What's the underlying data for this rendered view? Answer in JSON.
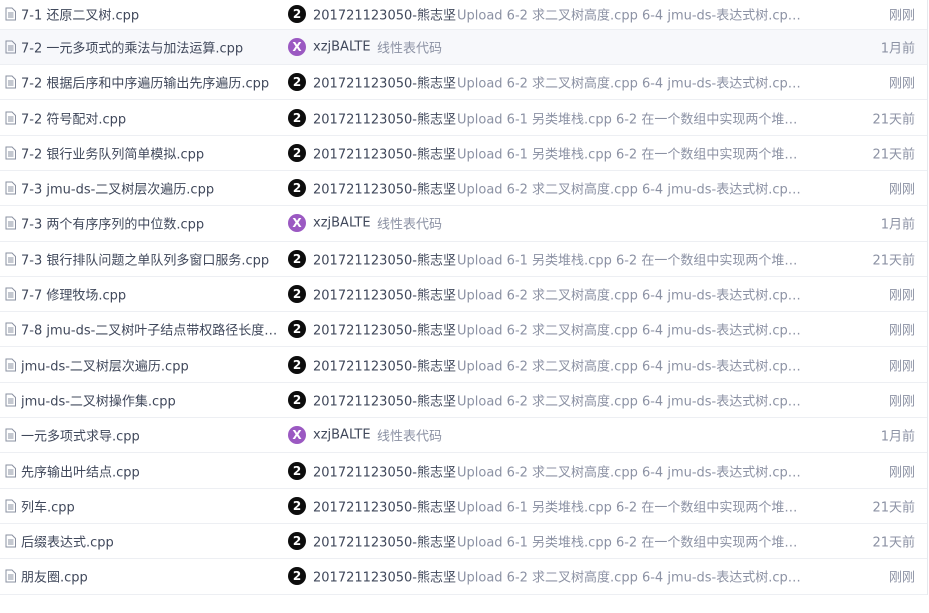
{
  "colors": {
    "avatar_black": "#0d0d0d",
    "avatar_purple": "#9b59c2",
    "link_text": "#40485b",
    "muted_text": "#8c92a4"
  },
  "files": [
    {
      "name": "7-1 还原二叉树.cpp",
      "avatar": "2",
      "avatar_style": "black",
      "author": "201721123050-熊志坚",
      "message": "Upload 6-2 求二叉树高度.cpp 6-4 jmu-ds-表达式树.cpp 7...",
      "time": "刚刚",
      "icon": "file-icon"
    },
    {
      "name": "7-2 一元多项式的乘法与加法运算.cpp",
      "avatar": "X",
      "avatar_style": "purple",
      "author": "xzjBALTE",
      "message": "线性表代码",
      "time": "1月前",
      "icon": "file-icon"
    },
    {
      "name": "7-2 根据后序和中序遍历输出先序遍历.cpp",
      "avatar": "2",
      "avatar_style": "black",
      "author": "201721123050-熊志坚",
      "message": "Upload 6-2 求二叉树高度.cpp 6-4 jmu-ds-表达式树.cpp 7...",
      "time": "刚刚",
      "icon": "file-icon"
    },
    {
      "name": "7-2 符号配对.cpp",
      "avatar": "2",
      "avatar_style": "black",
      "author": "201721123050-熊志坚",
      "message": "Upload 6-1 另类堆栈.cpp 6-2 在一个数组中实现两个堆栈...",
      "time": "21天前",
      "icon": "file-icon"
    },
    {
      "name": "7-2 银行业务队列简单模拟.cpp",
      "avatar": "2",
      "avatar_style": "black",
      "author": "201721123050-熊志坚",
      "message": "Upload 6-1 另类堆栈.cpp 6-2 在一个数组中实现两个堆栈...",
      "time": "21天前",
      "icon": "file-icon"
    },
    {
      "name": "7-3 jmu-ds-二叉树层次遍历.cpp",
      "avatar": "2",
      "avatar_style": "black",
      "author": "201721123050-熊志坚",
      "message": "Upload 6-2 求二叉树高度.cpp 6-4 jmu-ds-表达式树.cpp 7...",
      "time": "刚刚",
      "icon": "file-icon"
    },
    {
      "name": "7-3 两个有序序列的中位数.cpp",
      "avatar": "X",
      "avatar_style": "purple",
      "author": "xzjBALTE",
      "message": "线性表代码",
      "time": "1月前",
      "icon": "file-icon"
    },
    {
      "name": "7-3 银行排队问题之单队列多窗口服务.cpp",
      "avatar": "2",
      "avatar_style": "black",
      "author": "201721123050-熊志坚",
      "message": "Upload 6-1 另类堆栈.cpp 6-2 在一个数组中实现两个堆栈...",
      "time": "21天前",
      "icon": "file-icon"
    },
    {
      "name": "7-7 修理牧场.cpp",
      "avatar": "2",
      "avatar_style": "black",
      "author": "201721123050-熊志坚",
      "message": "Upload 6-2 求二叉树高度.cpp 6-4 jmu-ds-表达式树.cpp 7...",
      "time": "刚刚",
      "icon": "file-icon"
    },
    {
      "name": "7-8 jmu-ds-二叉树叶子结点带权路径长度和...",
      "avatar": "2",
      "avatar_style": "black",
      "author": "201721123050-熊志坚",
      "message": "Upload 6-2 求二叉树高度.cpp 6-4 jmu-ds-表达式树.cpp 7...",
      "time": "刚刚",
      "icon": "file-icon"
    },
    {
      "name": "jmu-ds-二叉树层次遍历.cpp",
      "avatar": "2",
      "avatar_style": "black",
      "author": "201721123050-熊志坚",
      "message": "Upload 6-2 求二叉树高度.cpp 6-4 jmu-ds-表达式树.cpp 7...",
      "time": "刚刚",
      "icon": "file-icon"
    },
    {
      "name": "jmu-ds-二叉树操作集.cpp",
      "avatar": "2",
      "avatar_style": "black",
      "author": "201721123050-熊志坚",
      "message": "Upload 6-2 求二叉树高度.cpp 6-4 jmu-ds-表达式树.cpp 7...",
      "time": "刚刚",
      "icon": "file-icon"
    },
    {
      "name": "一元多项式求导.cpp",
      "avatar": "X",
      "avatar_style": "purple",
      "author": "xzjBALTE",
      "message": "线性表代码",
      "time": "1月前",
      "icon": "file-icon"
    },
    {
      "name": "先序输出叶结点.cpp",
      "avatar": "2",
      "avatar_style": "black",
      "author": "201721123050-熊志坚",
      "message": "Upload 6-2 求二叉树高度.cpp 6-4 jmu-ds-表达式树.cpp 7...",
      "time": "刚刚",
      "icon": "file-icon"
    },
    {
      "name": "列车.cpp",
      "avatar": "2",
      "avatar_style": "black",
      "author": "201721123050-熊志坚",
      "message": "Upload 6-1 另类堆栈.cpp 6-2 在一个数组中实现两个堆栈...",
      "time": "21天前",
      "icon": "file-icon"
    },
    {
      "name": "后缀表达式.cpp",
      "avatar": "2",
      "avatar_style": "black",
      "author": "201721123050-熊志坚",
      "message": "Upload 6-1 另类堆栈.cpp 6-2 在一个数组中实现两个堆栈...",
      "time": "21天前",
      "icon": "file-icon"
    },
    {
      "name": "朋友圈.cpp",
      "avatar": "2",
      "avatar_style": "black",
      "author": "201721123050-熊志坚",
      "message": "Upload 6-2 求二叉树高度.cpp 6-4 jmu-ds-表达式树.cpp 7...",
      "time": "刚刚",
      "icon": "file-icon"
    }
  ]
}
